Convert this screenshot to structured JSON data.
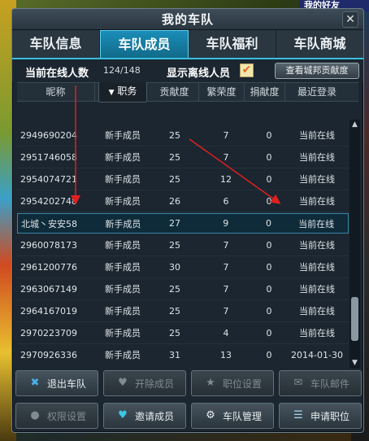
{
  "background": {
    "top_right_text": "我的好友"
  },
  "window": {
    "title": "我的车队",
    "close_symbol": "✕"
  },
  "tabs": [
    {
      "label": "车队信息",
      "active": false
    },
    {
      "label": "车队成员",
      "active": true
    },
    {
      "label": "车队福利",
      "active": false
    },
    {
      "label": "车队商城",
      "active": false
    }
  ],
  "infobar": {
    "online_label": "当前在线人数",
    "online_count": "124/148",
    "offline_label": "显示离线人员",
    "offline_checked": true,
    "check_symbol": "✔",
    "contrib_button": "查看城邦贡献度"
  },
  "table": {
    "headers": [
      "昵称",
      "职务",
      "贡献度",
      "繁荣度",
      "捐献度",
      "最近登录"
    ],
    "sort_symbol": "▼",
    "rows": [
      {
        "id": "2949690204",
        "role": "新手成员",
        "contrib": "25",
        "glory": "7",
        "donate": "0",
        "login": "当前在线"
      },
      {
        "id": "2951746058",
        "role": "新手成员",
        "contrib": "25",
        "glory": "7",
        "donate": "0",
        "login": "当前在线"
      },
      {
        "id": "2954074721",
        "role": "新手成员",
        "contrib": "25",
        "glory": "12",
        "donate": "0",
        "login": "当前在线"
      },
      {
        "id": "2954202748",
        "role": "新手成员",
        "contrib": "26",
        "glory": "6",
        "donate": "0",
        "login": "当前在线"
      },
      {
        "id": "北城丶安安58",
        "role": "新手成员",
        "contrib": "27",
        "glory": "9",
        "donate": "0",
        "login": "当前在线"
      },
      {
        "id": "2960078173",
        "role": "新手成员",
        "contrib": "25",
        "glory": "7",
        "donate": "0",
        "login": "当前在线"
      },
      {
        "id": "2961200776",
        "role": "新手成员",
        "contrib": "30",
        "glory": "7",
        "donate": "0",
        "login": "当前在线"
      },
      {
        "id": "2963067149",
        "role": "新手成员",
        "contrib": "25",
        "glory": "7",
        "donate": "0",
        "login": "当前在线"
      },
      {
        "id": "2964167019",
        "role": "新手成员",
        "contrib": "25",
        "glory": "7",
        "donate": "0",
        "login": "当前在线"
      },
      {
        "id": "2970223709",
        "role": "新手成员",
        "contrib": "25",
        "glory": "4",
        "donate": "0",
        "login": "当前在线"
      },
      {
        "id": "2970926336",
        "role": "新手成员",
        "contrib": "31",
        "glory": "13",
        "donate": "0",
        "login": "2014-01-30"
      }
    ],
    "highlighted_row": 4
  },
  "scrollbar": {
    "up_symbol": "▲",
    "down_symbol": "▼"
  },
  "buttons": [
    {
      "label": "退出车队",
      "icon": "x-icon",
      "icon_glyph": "✖",
      "enabled": true
    },
    {
      "label": "开除成员",
      "icon": "heart-broken-icon",
      "icon_glyph": "♥",
      "enabled": false
    },
    {
      "label": "职位设置",
      "icon": "star-icon",
      "icon_glyph": "★",
      "enabled": false
    },
    {
      "label": "车队邮件",
      "icon": "mail-icon",
      "icon_glyph": "✉",
      "enabled": false
    },
    {
      "label": "权限设置",
      "icon": "chat-icon",
      "icon_glyph": "●",
      "enabled": false
    },
    {
      "label": "邀请成员",
      "icon": "hearts-icon",
      "icon_glyph": "♥",
      "enabled": true
    },
    {
      "label": "车队管理",
      "icon": "wrench-icon",
      "icon_glyph": "⚙",
      "enabled": true
    },
    {
      "label": "申请职位",
      "icon": "document-icon",
      "icon_glyph": "☰",
      "enabled": true
    }
  ],
  "colors": {
    "accent": "#1a8eb8",
    "annotation_arrow": "#e02020",
    "checkbox_mark": "#e07020"
  }
}
